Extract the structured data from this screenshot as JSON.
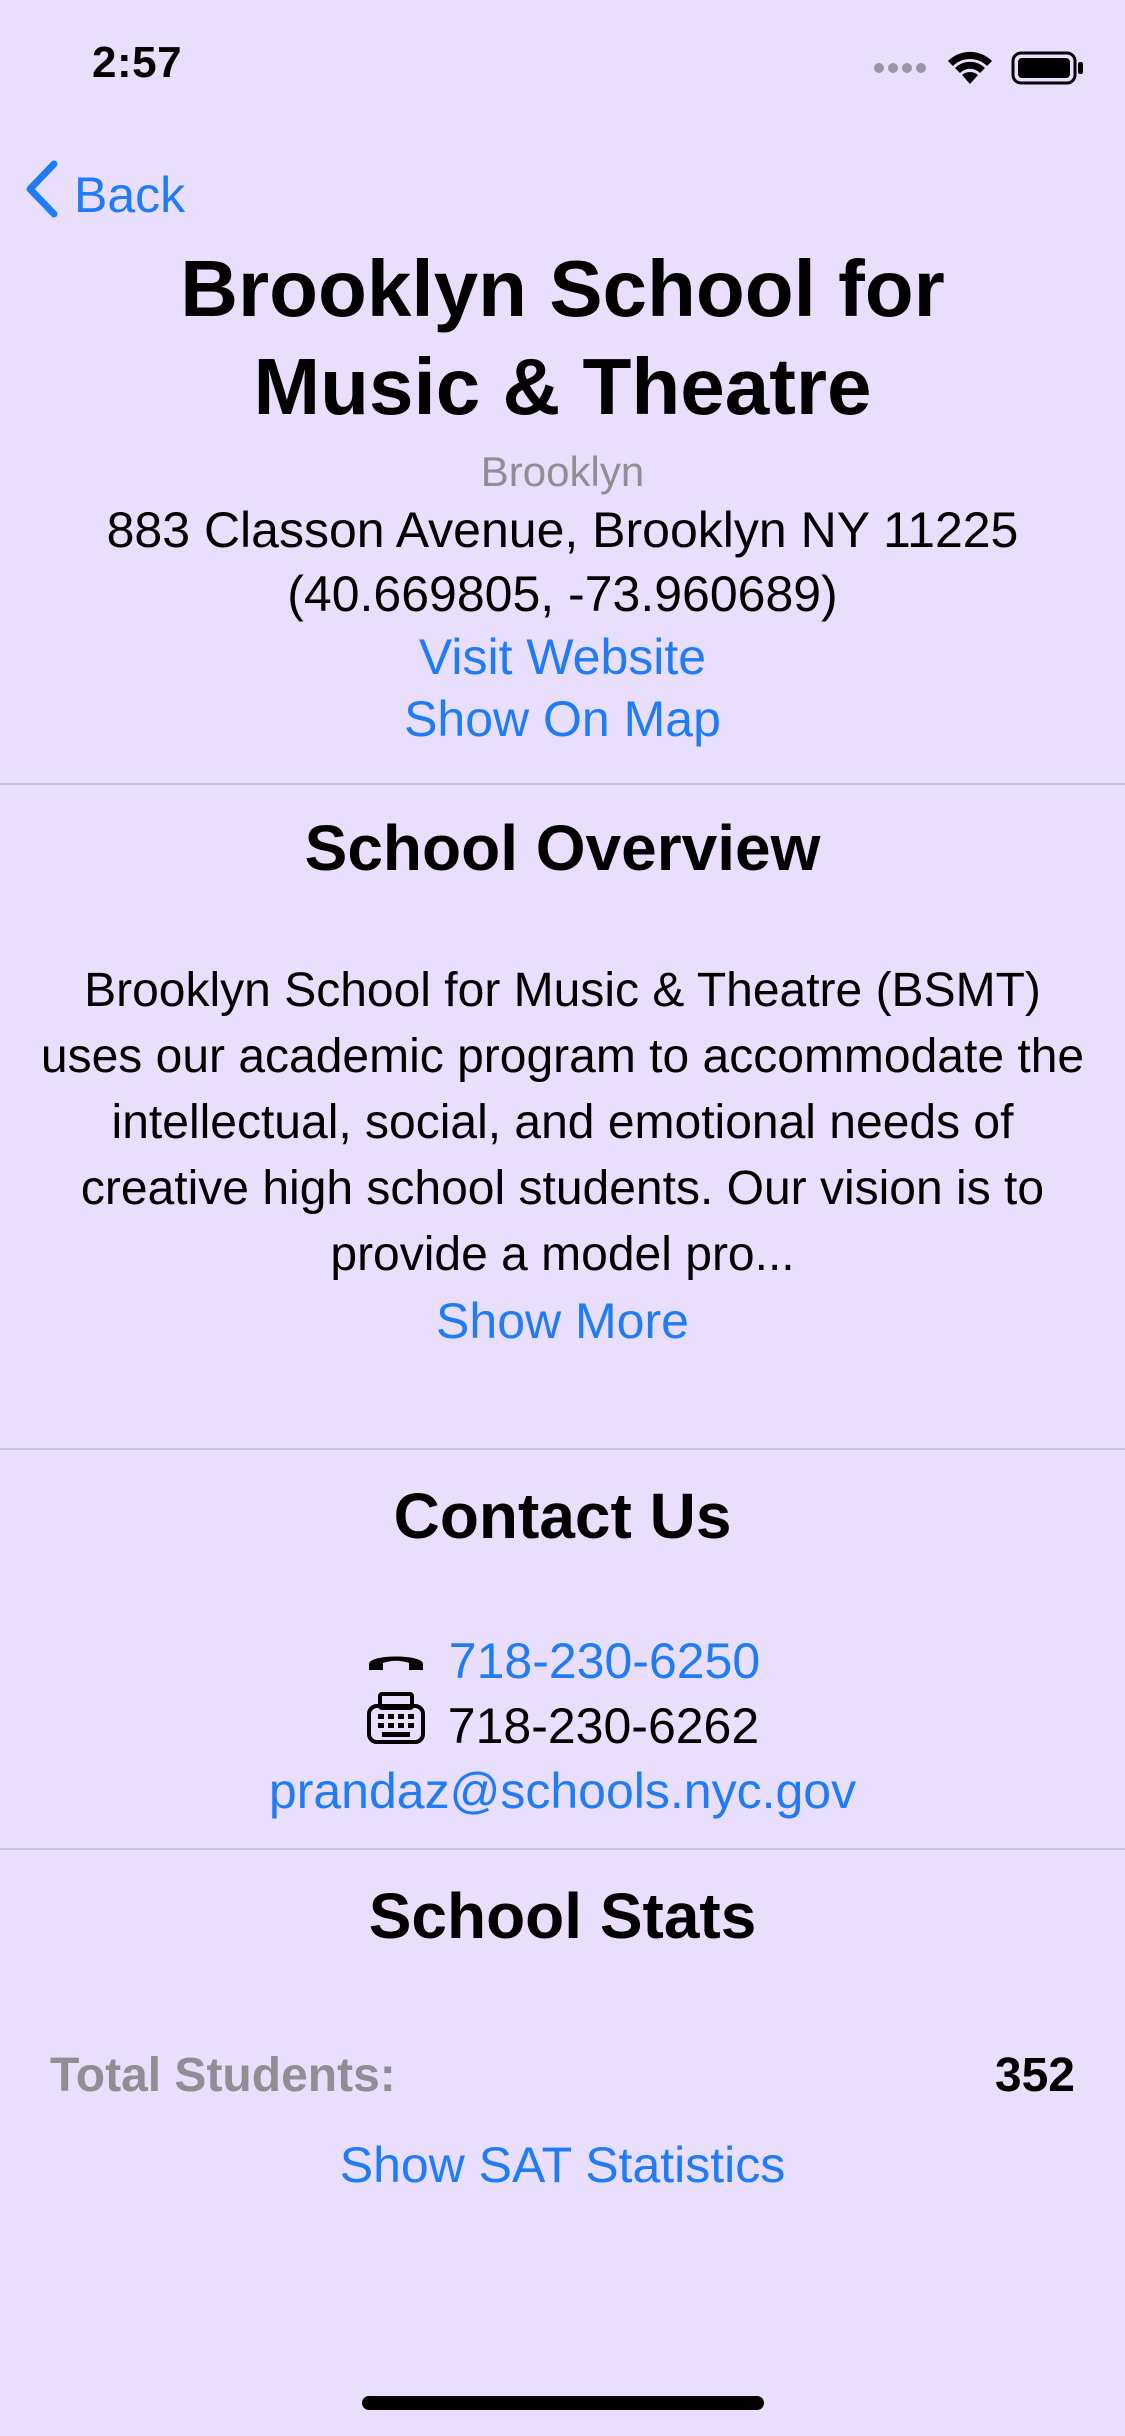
{
  "status_bar": {
    "time": "2:57",
    "icons": [
      "cellular-icon",
      "wifi-icon",
      "battery-icon"
    ]
  },
  "nav": {
    "back_label": "Back"
  },
  "school": {
    "name": "Brooklyn School for Music & Theatre",
    "borough": "Brooklyn",
    "address": "883 Classon Avenue, Brooklyn NY 11225",
    "coordinates": "(40.669805, -73.960689)",
    "website_label": "Visit Website",
    "map_label": "Show On Map"
  },
  "overview": {
    "title": "School Overview",
    "text": "Brooklyn School for Music & Theatre (BSMT) uses our academic program to accommodate the intellectual, social, and emotional needs of creative high school students. Our vision is to provide a model pro...",
    "show_more_label": "Show More"
  },
  "contact": {
    "title": "Contact Us",
    "phone": "718-230-6250",
    "fax": "718-230-6262",
    "email": "prandaz@schools.nyc.gov"
  },
  "stats": {
    "title": "School Stats",
    "total_students_label": "Total Students:",
    "total_students_value": "352",
    "sat_label": "Show SAT Statistics"
  },
  "colors": {
    "background": "#E9DEFC",
    "link": "#1F7CF5",
    "secondary_text": "#8E8E93"
  }
}
